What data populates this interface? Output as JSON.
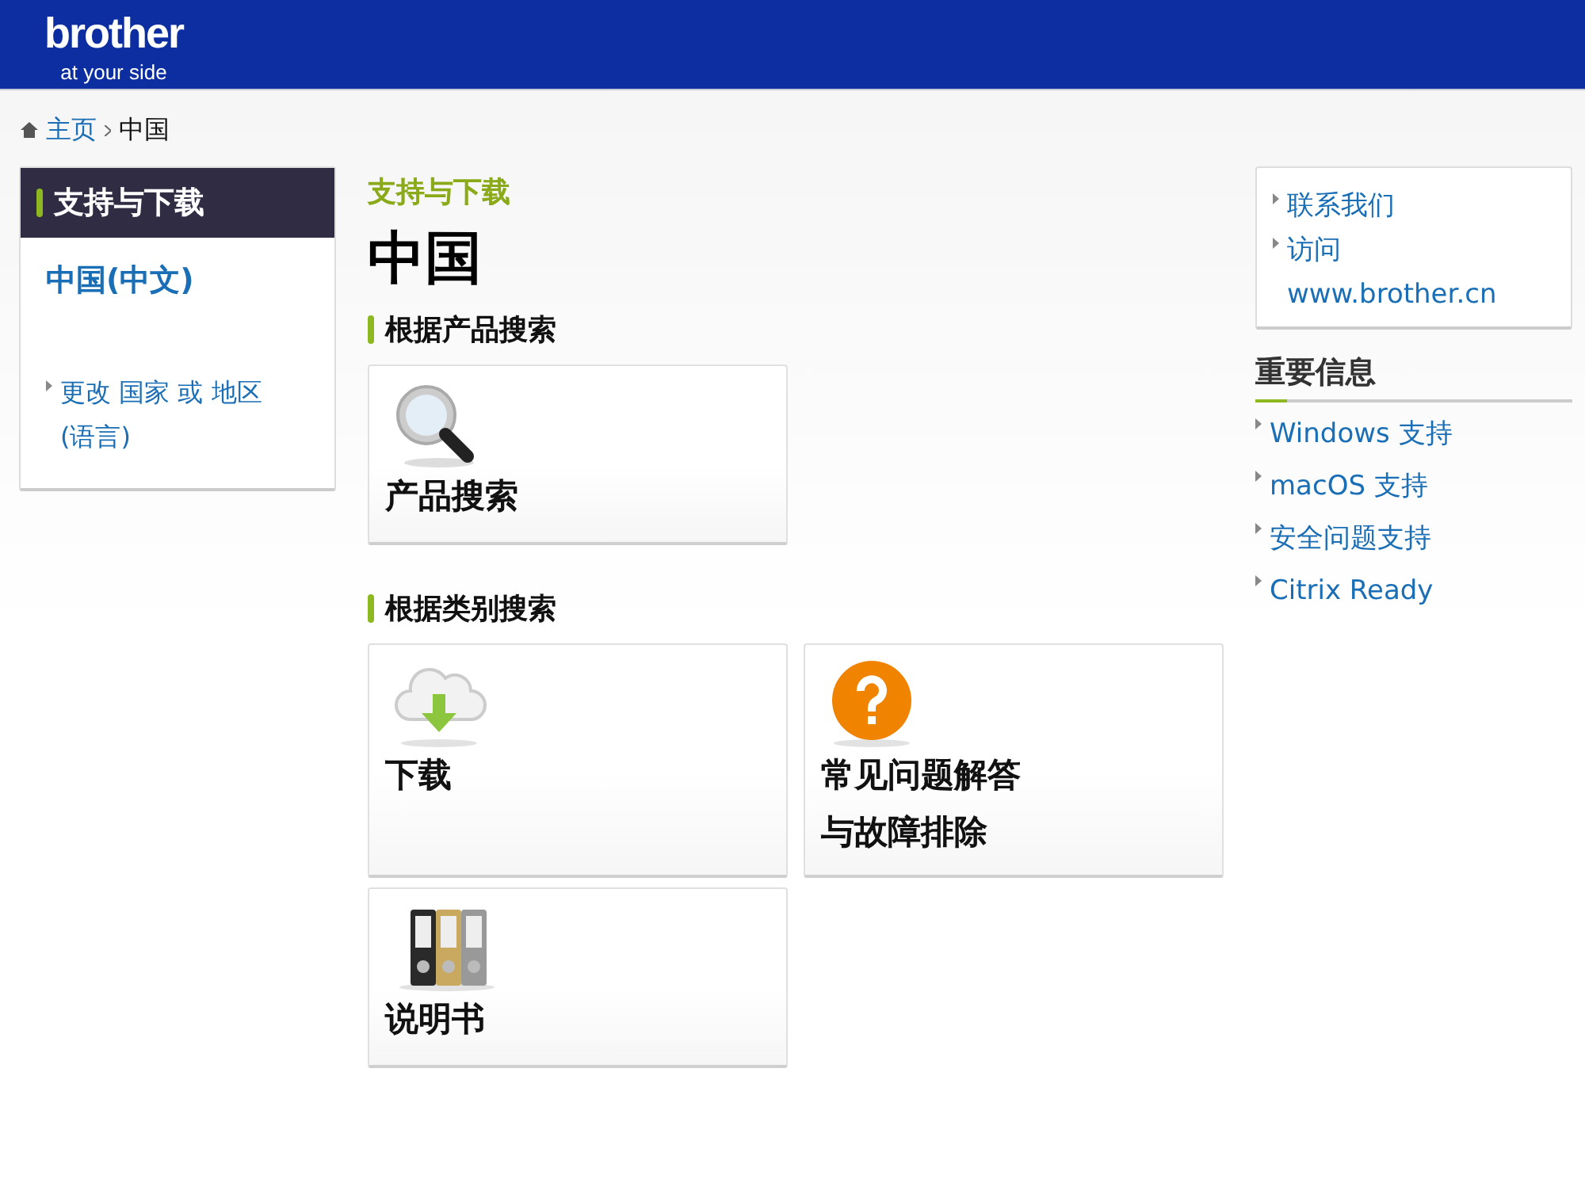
{
  "header": {
    "logo": "brother",
    "tagline": "at your side"
  },
  "breadcrumb": [
    {
      "label": "主页",
      "kind": "link"
    },
    {
      "label": "中国",
      "kind": "current"
    }
  ],
  "left_panel": {
    "title": "支持与下载",
    "region": "中国(中文)",
    "change_link": [
      "更改 国家 或 地区",
      "(语言)"
    ]
  },
  "main": {
    "section_label": "支持与下载",
    "heading": "中国",
    "sections": [
      {
        "title": "根据产品搜索",
        "cards": [
          {
            "kind": "search",
            "lines": [
              "产品搜索"
            ]
          }
        ]
      },
      {
        "title": "根据类别搜索",
        "cards": [
          {
            "kind": "download",
            "lines": [
              "下载"
            ]
          },
          {
            "kind": "faq",
            "lines": [
              "常见问题解答",
              "与故障排除"
            ]
          },
          {
            "kind": "manuals",
            "lines": [
              "说明书"
            ]
          }
        ]
      }
    ]
  },
  "right_sidebar": {
    "links": [
      {
        "lines": [
          "联系我们"
        ]
      },
      {
        "lines": [
          "访问",
          "www.brother.cn"
        ]
      }
    ],
    "info_title": "重要信息",
    "info_links": [
      "Windows 支持",
      "macOS 支持",
      "安全问题支持",
      "Citrix Ready"
    ]
  }
}
